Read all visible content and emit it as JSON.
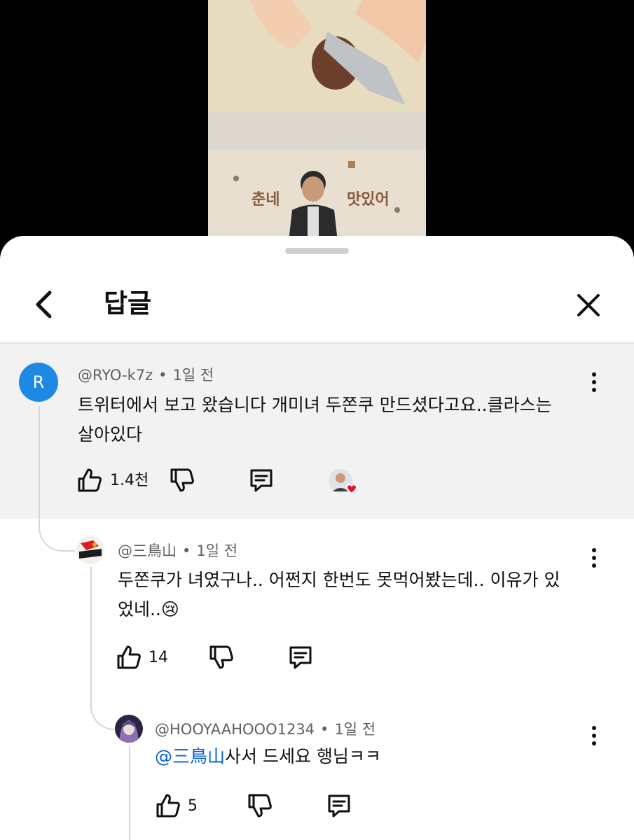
{
  "video": {
    "overlay_text_left": "춘네",
    "overlay_text_right": "맛있어"
  },
  "panel": {
    "title": "답글",
    "back_icon": "chevron-left-icon",
    "close_icon": "close-icon"
  },
  "parent_comment": {
    "avatar_letter": "R",
    "author": "@RYO-k7z",
    "separator": "•",
    "time": "1일 전",
    "text_line1": "트위터에서 보고 왔습니다 개미녀 두쫀쿠 만드셨다고요..클라스는",
    "text_line2": "살아있다",
    "like_count": "1.4천",
    "creator_heart": "heart-icon"
  },
  "reply1": {
    "author": "@三鳥山",
    "separator": "•",
    "time": "1일 전",
    "text_line1": "두쫀쿠가 녀였구나.. 어쩐지 한번도 못먹어봤는데.. 이유가 있",
    "text_line2": "었네..😢",
    "like_count": "14"
  },
  "reply2": {
    "author": "@HOOYAAHOOO1234",
    "separator": "•",
    "time": "1일 전",
    "mention": "@三鳥山",
    "text": "사서 드세요 행님ㅋㅋ",
    "like_count": "5"
  },
  "colors": {
    "accent": "#065fd4",
    "avatar_blue": "#1e88e5",
    "heart": "#e5112d"
  }
}
